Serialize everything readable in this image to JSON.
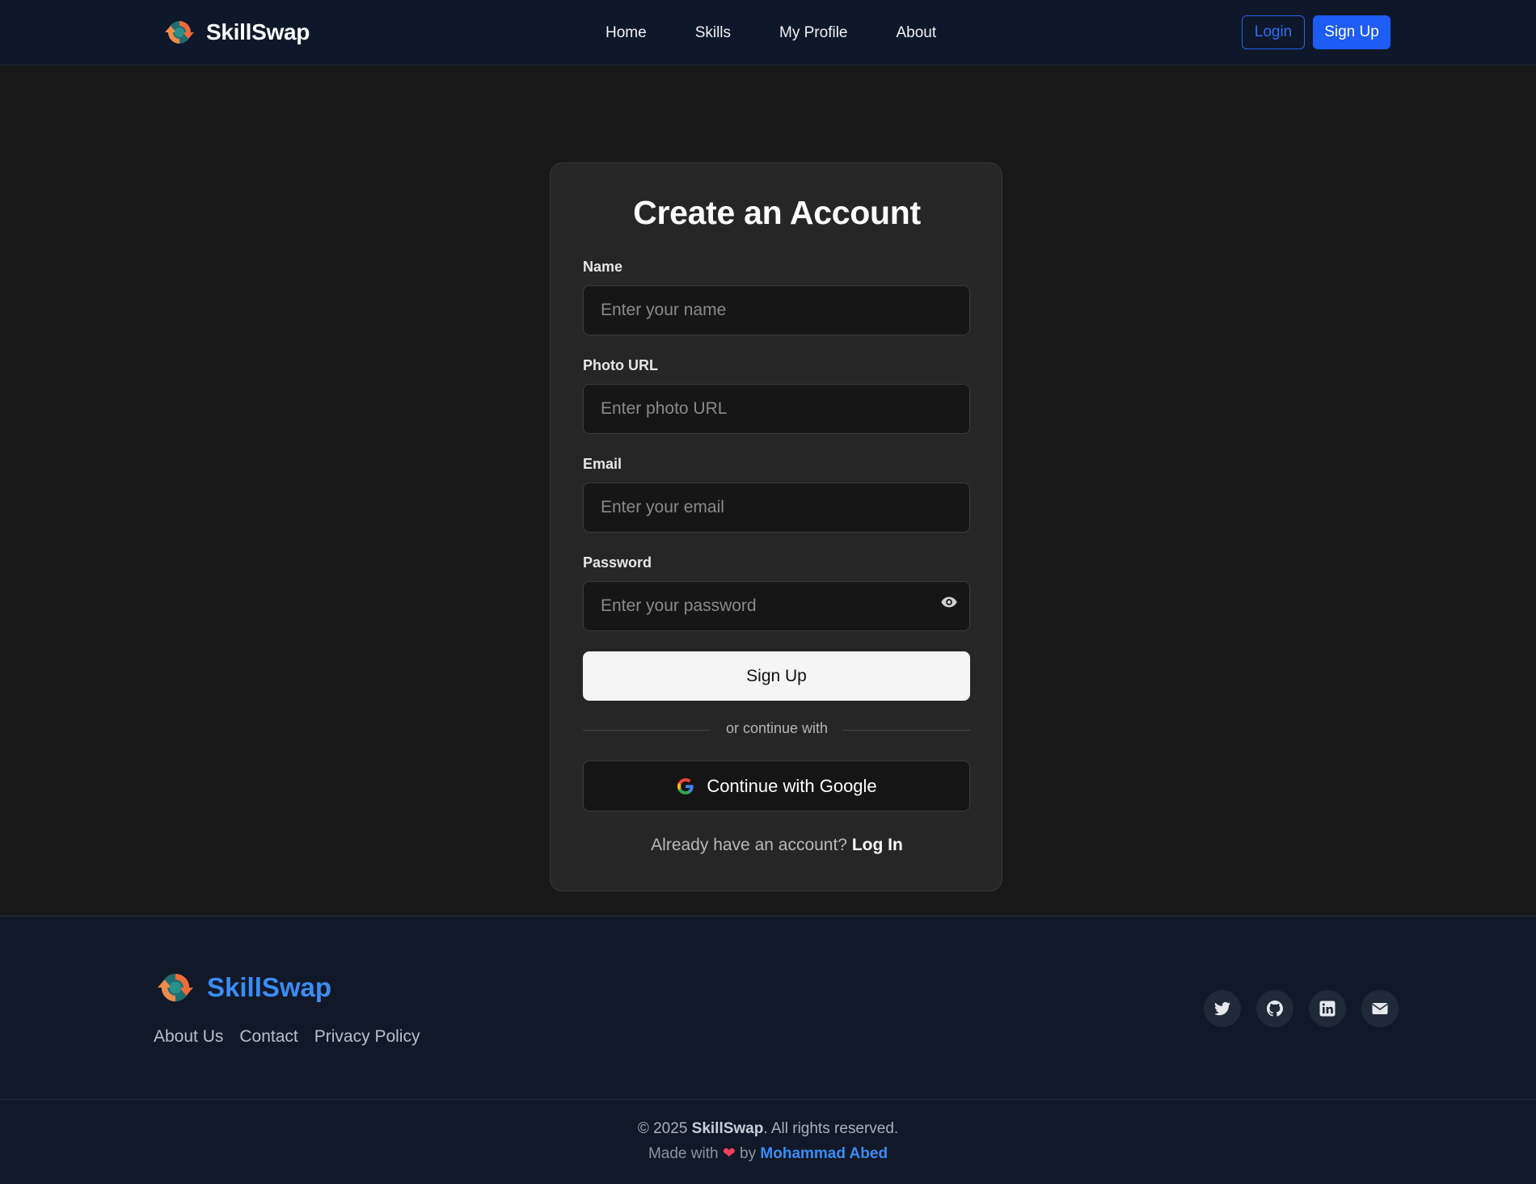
{
  "brand": {
    "name": "SkillSwap",
    "logo_icon": "circular-arrows-logo-icon"
  },
  "nav": {
    "links": [
      "Home",
      "Skills",
      "My Profile",
      "About"
    ],
    "login_label": "Login",
    "signup_label": "Sign Up"
  },
  "form": {
    "title": "Create an Account",
    "fields": [
      {
        "label": "Name",
        "placeholder": "Enter your name",
        "value": ""
      },
      {
        "label": "Photo URL",
        "placeholder": "Enter photo URL",
        "value": ""
      },
      {
        "label": "Email",
        "placeholder": "Enter your email",
        "value": ""
      },
      {
        "label": "Password",
        "placeholder": "Enter your password",
        "value": ""
      }
    ],
    "password_toggle_icon": "eye-icon",
    "submit_label": "Sign Up",
    "divider_text": "or continue with",
    "google_label": "Continue with Google",
    "login_prompt": "Already have an account?",
    "login_link": "Log In"
  },
  "footer": {
    "brand_name": "SkillSwap",
    "links": [
      "About Us",
      "Contact",
      "Privacy Policy"
    ],
    "social_icons": [
      "twitter-icon",
      "github-icon",
      "linkedin-icon",
      "envelope-icon"
    ],
    "copyright_prefix": "© 2025",
    "copyright_brand": "SkillSwap",
    "copyright_suffix": ". All rights reserved.",
    "made_with_prefix": "Made with",
    "made_with_by": "by",
    "author": "Mohammad Abed"
  },
  "colors": {
    "accent": "#1d5cf5",
    "nav_background": "#0f172a",
    "page_background": "#181818",
    "card_background": "#262626",
    "footer_brand": "#3b8cf5",
    "heart": "#f43f5e"
  }
}
